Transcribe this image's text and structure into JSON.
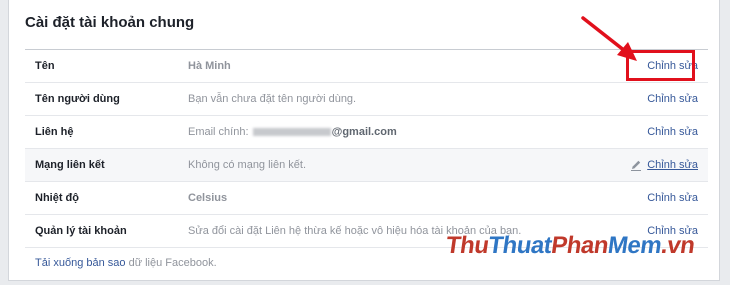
{
  "section_title": "Cài đặt tài khoản chung",
  "edit_label": "Chỉnh sửa",
  "rows": [
    {
      "label": "Tên",
      "value": "Hà Minh"
    },
    {
      "label": "Tên người dùng",
      "value": "Bạn vẫn chưa đặt tên người dùng."
    },
    {
      "label": "Liên hệ",
      "value_prefix": "Email chính:",
      "value_suffix": "@gmail.com"
    },
    {
      "label": "Mạng liên kết",
      "value": "Không có mạng liên kết."
    },
    {
      "label": "Nhiệt độ",
      "value": "Celsius"
    },
    {
      "label": "Quản lý tài khoản",
      "value": "Sửa đổi cài đặt Liên hệ thừa kế hoặc vô hiệu hóa tài khoản của bạn."
    }
  ],
  "footer": {
    "link_part": "Tải xuống bản sao",
    "plain_part": " dữ liệu Facebook."
  },
  "watermark": {
    "p1": "Thu",
    "p2": "Thuat",
    "p3": "Phan",
    "p4": "Mem",
    "p5": ".vn"
  },
  "colors": {
    "link": "#365899",
    "annotation": "#e1101c",
    "background": "#e9ebee"
  },
  "icons": {
    "pencil": "pencil-icon",
    "arrow": "red-arrow-annotation"
  }
}
